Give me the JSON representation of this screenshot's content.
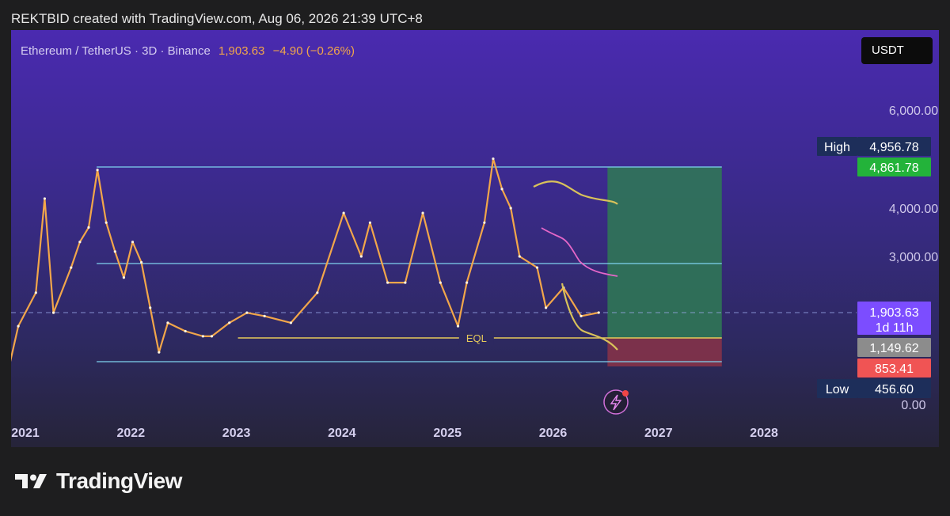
{
  "attribution": "REKTBID created with TradingView.com, Aug 06, 2026 21:39 UTC+8",
  "header": {
    "symbol": "Ethereum / TetherUS · 3D · Binance",
    "price": "1,903.63",
    "change": "−4.90 (−0.26%)"
  },
  "currency": "USDT",
  "brand": "TradingView",
  "icons": {
    "logo": "tradingview-logo-icon",
    "alert": "lightning-alert-icon"
  },
  "colors": {
    "candle": "#f2a64a",
    "level_line": "#7fd3f0",
    "eql_line": "#e6c95a",
    "trend_yellow": "#d9c25a",
    "trend_pink": "#e567c8",
    "profit_zone": "#2f7a55",
    "loss_zone": "#8a3248",
    "price_tag": "#7c4dff",
    "high_green": "#23b33a",
    "gray_tag": "#8c8c8c",
    "red_tag": "#f05454",
    "navy_tag": "#1d2e5a"
  },
  "chart_data": {
    "type": "line",
    "title": "Ethereum / TetherUS · 3D · Binance",
    "x_ticks": [
      "2021",
      "2022",
      "2023",
      "2024",
      "2025",
      "2026",
      "2027",
      "2028"
    ],
    "y_ticks": [
      "6,000.00",
      "4,000.00",
      "3,000.00",
      "0.00"
    ],
    "series": [
      {
        "name": "",
        "points": [
          [
            "2021-01",
            730
          ],
          [
            "2021-02",
            1500
          ],
          [
            "2021-04",
            2300
          ],
          [
            "2021-05",
            4200
          ],
          [
            "2021-06",
            1900
          ],
          [
            "2021-08",
            2800
          ],
          [
            "2021-09",
            3300
          ],
          [
            "2021-10",
            3600
          ],
          [
            "2021-11",
            4800
          ],
          [
            "2021-12",
            3700
          ],
          [
            "2022-01",
            3100
          ],
          [
            "2022-02",
            2600
          ],
          [
            "2022-03",
            3300
          ],
          [
            "2022-04",
            2900
          ],
          [
            "2022-05",
            2000
          ],
          [
            "2022-06",
            1000
          ],
          [
            "2022-07",
            1600
          ],
          [
            "2022-09",
            1350
          ],
          [
            "2022-11",
            1200
          ],
          [
            "2022-12",
            1200
          ],
          [
            "2023-02",
            1600
          ],
          [
            "2023-04",
            1900
          ],
          [
            "2023-06",
            1800
          ],
          [
            "2023-09",
            1600
          ],
          [
            "2023-12",
            2300
          ],
          [
            "2024-03",
            3900
          ],
          [
            "2024-05",
            3000
          ],
          [
            "2024-06",
            3700
          ],
          [
            "2024-08",
            2500
          ],
          [
            "2024-10",
            2500
          ],
          [
            "2024-12",
            3900
          ],
          [
            "2025-02",
            2500
          ],
          [
            "2025-04",
            1500
          ],
          [
            "2025-05",
            2500
          ],
          [
            "2025-07",
            3700
          ],
          [
            "2025-08",
            4900
          ],
          [
            "2025-09",
            4400
          ],
          [
            "2025-10",
            4000
          ],
          [
            "2025-11",
            3000
          ],
          [
            "2026-01",
            2800
          ],
          [
            "2026-02",
            2000
          ],
          [
            "2026-04",
            2400
          ],
          [
            "2026-06",
            1800
          ],
          [
            "2026-08",
            1903.63
          ]
        ]
      }
    ],
    "annotations": [
      {
        "type": "horizontal",
        "value": 4861.78
      },
      {
        "type": "horizontal",
        "value": 2880
      },
      {
        "type": "horizontal",
        "value": 456.6
      },
      {
        "type": "horizontal",
        "value": 1149.62,
        "label": "EQL"
      },
      {
        "type": "price_line",
        "value": 1903.63
      },
      {
        "type": "long_position",
        "entry": 1149.62,
        "target": 4861.78,
        "stop": 853.41,
        "start": "2026-09",
        "end": "2027-10"
      }
    ],
    "price_tags": {
      "high_label": "High",
      "high_value": "4,956.78",
      "target": "4,861.78",
      "last": "1,903.63",
      "countdown": "1d 11h",
      "entry": "1,149.62",
      "stop": "853.41",
      "low_label": "Low",
      "low_value": "456.60"
    },
    "grid": false,
    "legend": "none"
  }
}
